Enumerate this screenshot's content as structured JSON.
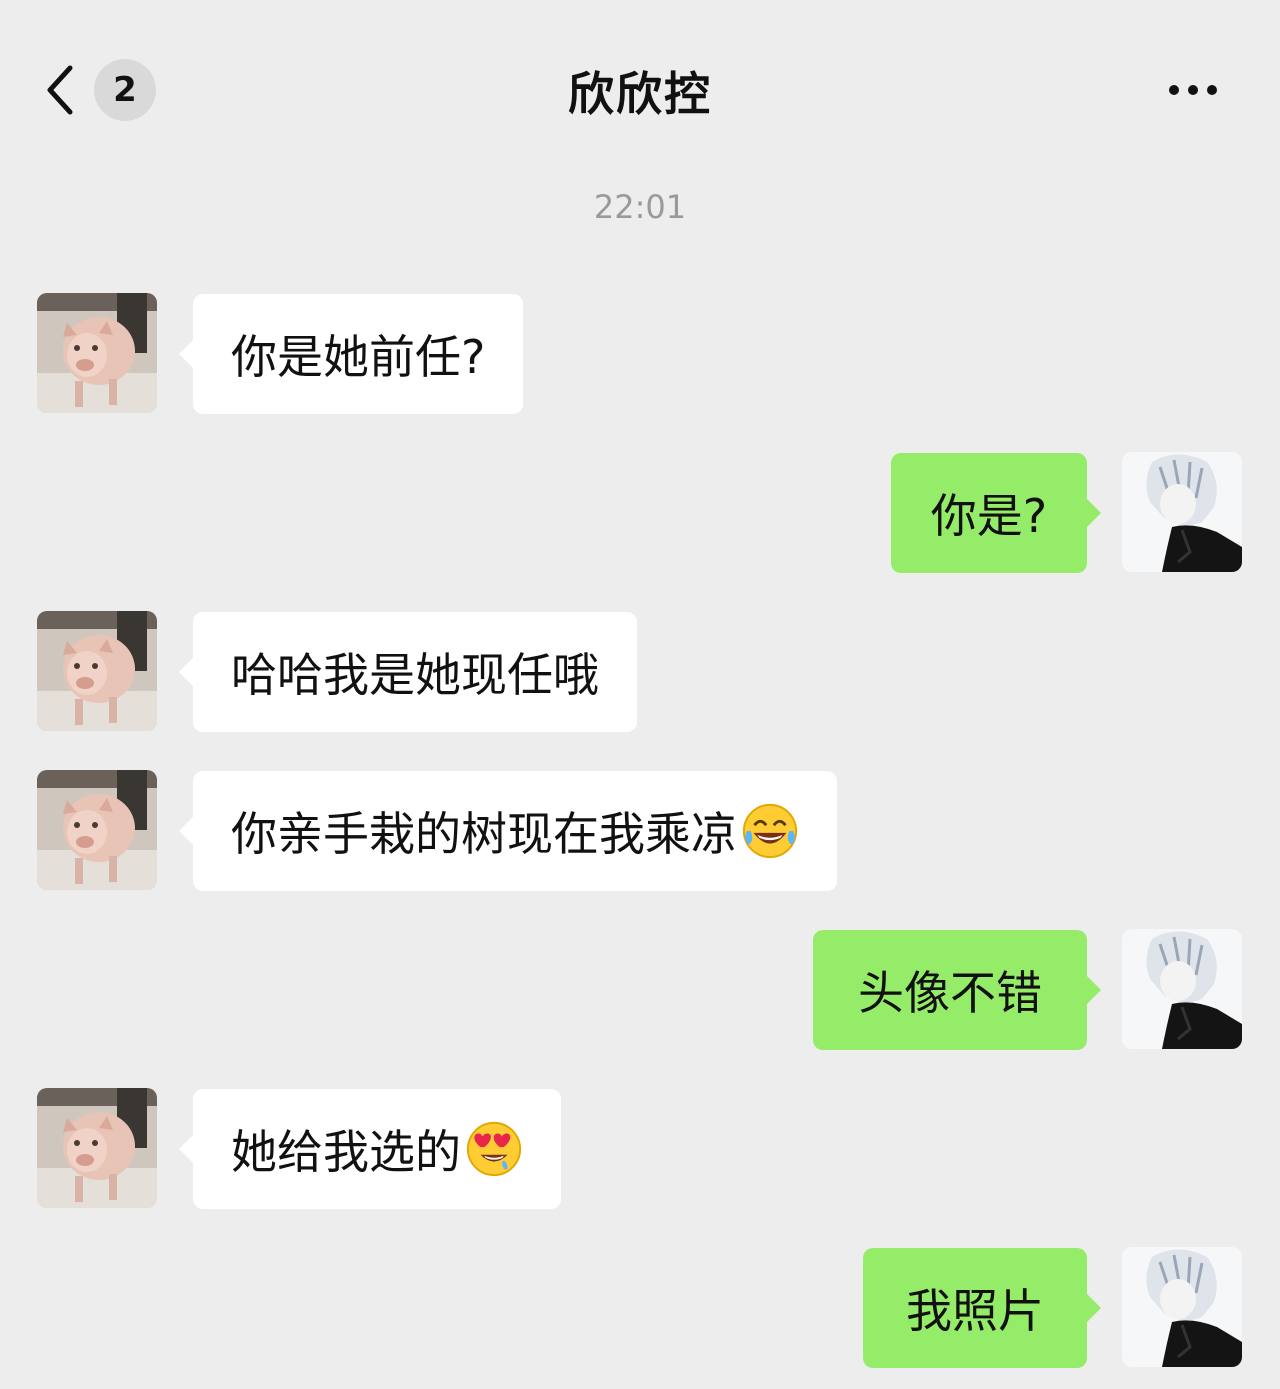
{
  "header": {
    "back_icon": "chevron-left-icon",
    "unread_badge": "2",
    "title": "欣欣控",
    "more_icon": "more-horizontal-icon"
  },
  "timestamp": "22:01",
  "colors": {
    "background": "#ededed",
    "incoming_bubble": "#ffffff",
    "outgoing_bubble": "#95ec69"
  },
  "messages": [
    {
      "side": "in",
      "text": "你是她前任?",
      "avatar": "pig-avatar"
    },
    {
      "side": "out",
      "text": "你是?",
      "avatar": "anime-avatar"
    },
    {
      "side": "in",
      "text": "哈哈我是她现任哦",
      "avatar": "pig-avatar"
    },
    {
      "side": "in",
      "text": "你亲手栽的树现在我乘凉",
      "emoji": "tears-of-joy-emoji",
      "avatar": "pig-avatar"
    },
    {
      "side": "out",
      "text": "头像不错",
      "avatar": "anime-avatar"
    },
    {
      "side": "in",
      "text": "她给我选的",
      "emoji": "heart-eyes-drooling-emoji",
      "avatar": "pig-avatar"
    },
    {
      "side": "out",
      "text": "我照片",
      "avatar": "anime-avatar"
    }
  ]
}
